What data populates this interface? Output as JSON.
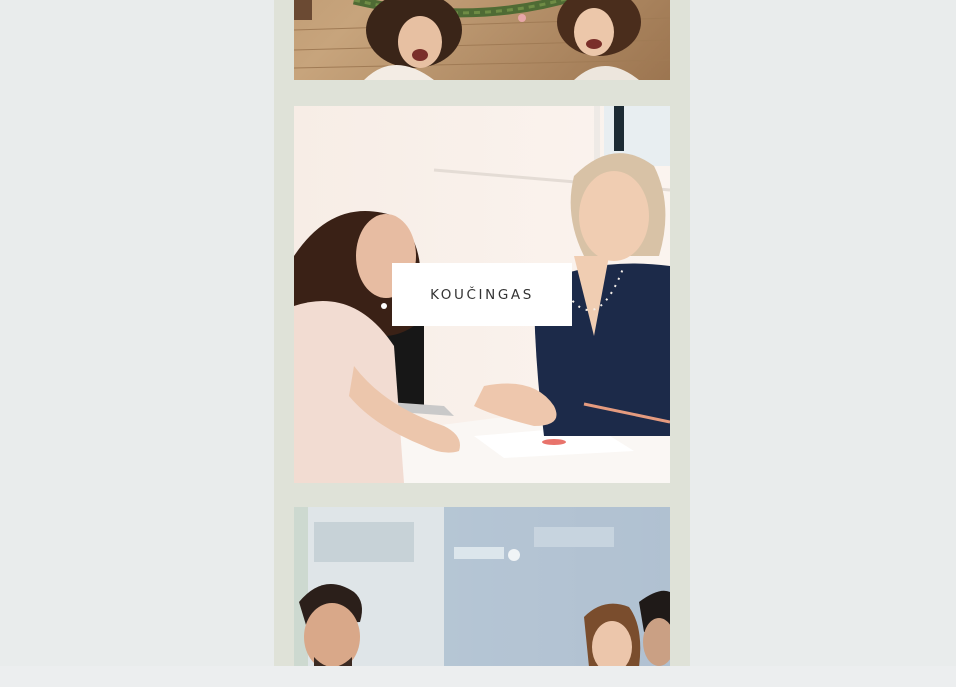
{
  "cards": [
    {
      "image": "three-women-laughing-on-floor-with-wreath",
      "label": ""
    },
    {
      "image": "two-women-coaching-session-at-desk",
      "label": "KOUČINGAS"
    },
    {
      "image": "business-team-meeting-in-office",
      "label": ""
    }
  ],
  "colors": {
    "page_background": "#e9ecec",
    "column_background": "#dfe2d8",
    "label_background": "#ffffff",
    "label_text": "#333333"
  }
}
